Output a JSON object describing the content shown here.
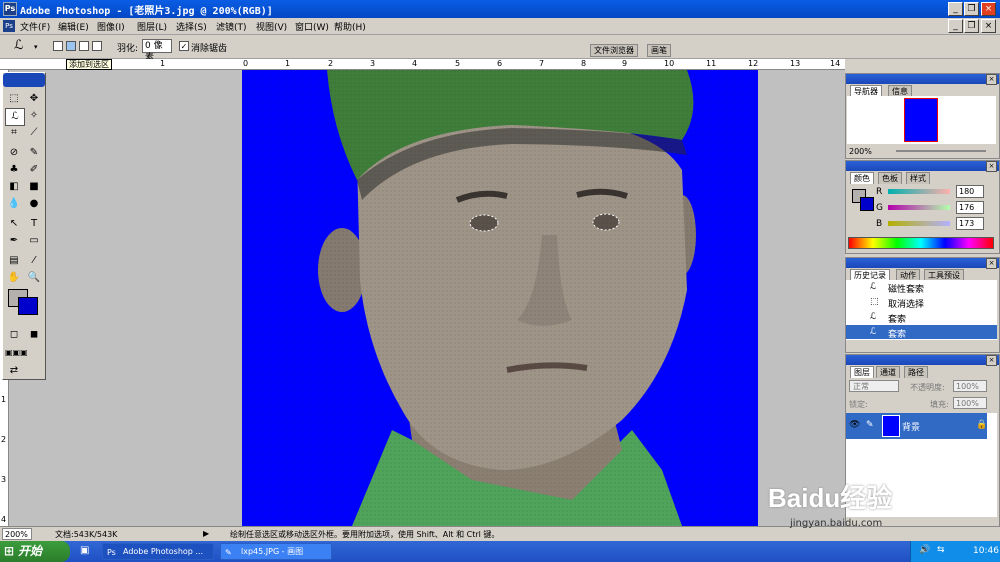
{
  "window": {
    "title": "Adobe Photoshop - [老照片3.jpg @ 200%(RGB)]",
    "app_icon": "photoshop-icon"
  },
  "menu": [
    "文件(F)",
    "编辑(E)",
    "图像(I)",
    "图层(L)",
    "选择(S)",
    "滤镜(T)",
    "视图(V)",
    "窗口(W)",
    "帮助(H)"
  ],
  "options": {
    "feather_label": "羽化:",
    "feather_value": "0 像素",
    "antialias_label": "消除锯齿",
    "tooltip": "添加到选区",
    "tab_browser": "文件浏览器",
    "tab_brush": "画笔"
  },
  "ruler": {
    "top": [
      "1",
      "0",
      "1",
      "2",
      "3",
      "4",
      "5",
      "6",
      "7",
      "8",
      "9",
      "10",
      "11",
      "12",
      "13",
      "14"
    ],
    "left": [
      "1",
      "2",
      "3",
      "4"
    ]
  },
  "navigator": {
    "tabs": [
      "导航器",
      "信息"
    ],
    "zoom": "200%"
  },
  "color": {
    "tabs": [
      "颜色",
      "色板",
      "样式"
    ],
    "r_label": "R",
    "g_label": "G",
    "b_label": "B",
    "r": "180",
    "g": "176",
    "b": "173",
    "fg": "#b4b0ad",
    "bg": "#0000cc"
  },
  "history": {
    "tabs": [
      "历史记录",
      "动作",
      "工具预设"
    ],
    "items": [
      "磁性套索",
      "取消选择",
      "套索",
      "套索"
    ]
  },
  "layers": {
    "tabs": [
      "图层",
      "通道",
      "路径"
    ],
    "mode": "正常",
    "opacity_label": "不透明度:",
    "opacity": "100%",
    "lock_label": "锁定:",
    "fill_label": "填充:",
    "fill": "100%",
    "layer_name": "背景"
  },
  "status": {
    "zoom": "200%",
    "doc": "文档:543K/543K",
    "hint": "绘制任意选区或移动选区外框。要用附加选项，使用 Shift、Alt 和 Ctrl 键。"
  },
  "taskbar": {
    "start": "开始",
    "items": [
      "Adobe Photoshop ...",
      "lxp45.JPG - 画图"
    ],
    "time": "10:46"
  },
  "watermark": {
    "brand": "Baidu经验",
    "url": "jingyan.baidu.com"
  }
}
